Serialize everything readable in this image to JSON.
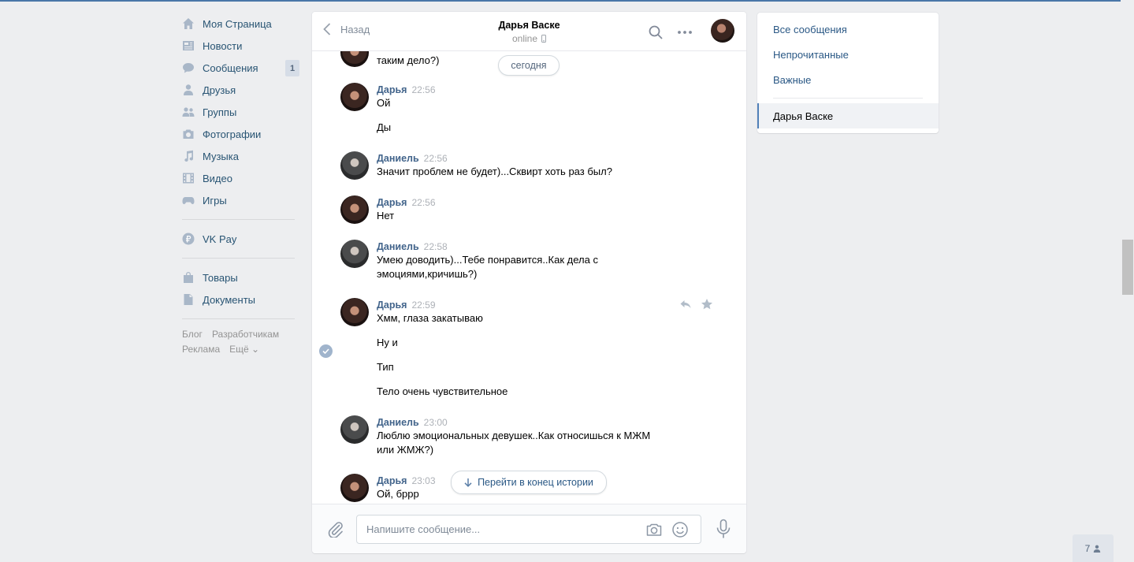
{
  "nav": {
    "items": [
      {
        "label": "Моя Страница",
        "icon": "home-icon"
      },
      {
        "label": "Новости",
        "icon": "news-icon"
      },
      {
        "label": "Сообщения",
        "icon": "messages-icon",
        "badge": "1"
      },
      {
        "label": "Друзья",
        "icon": "friends-icon"
      },
      {
        "label": "Группы",
        "icon": "groups-icon"
      },
      {
        "label": "Фотографии",
        "icon": "camera-icon"
      },
      {
        "label": "Музыка",
        "icon": "music-icon"
      },
      {
        "label": "Видео",
        "icon": "video-icon"
      },
      {
        "label": "Игры",
        "icon": "games-icon"
      }
    ],
    "vkpay": {
      "label": "VK Pay",
      "icon": "vkpay-icon"
    },
    "extra": [
      {
        "label": "Товары",
        "icon": "market-icon"
      },
      {
        "label": "Документы",
        "icon": "document-icon"
      }
    ],
    "footer": {
      "blog": "Блог",
      "developers": "Разработчикам",
      "ads": "Реклама",
      "more": "Ещё ⌄"
    }
  },
  "chat": {
    "back_label": "Назад",
    "peer_name": "Дарья Васке",
    "peer_status": "online",
    "today_label": "сегодня",
    "top_partial_text": "таким дело?)",
    "messages": [
      {
        "author": "Дарья",
        "time": "22:56",
        "lines": [
          "Ой",
          "Ды"
        ]
      },
      {
        "author": "Даниель",
        "time": "22:56",
        "lines": [
          "Значит проблем не будет)...Сквирт хоть раз был?"
        ]
      },
      {
        "author": "Дарья",
        "time": "22:56",
        "lines": [
          "Нет"
        ]
      },
      {
        "author": "Даниель",
        "time": "22:58",
        "lines": [
          "Умею доводить)...Тебе понравится..Как дела с эмоциями,кричишь?)"
        ]
      },
      {
        "author": "Дарья",
        "time": "22:59",
        "lines": [
          "Хмм, глаза закатываю",
          "Ну и",
          "Тип",
          "Тело очень чувствительное"
        ]
      },
      {
        "author": "Даниель",
        "time": "23:00",
        "lines": [
          "Люблю эмоциональных девушек..Как относишься к МЖМ или ЖМЖ?)"
        ]
      },
      {
        "author": "Дарья",
        "time": "23:03",
        "lines": [
          "Ой, бррр"
        ]
      }
    ],
    "jump_label": "Перейти в конец истории",
    "composer": {
      "placeholder": "Напишите сообщение..."
    }
  },
  "filters": {
    "all": "Все сообщения",
    "unread": "Непрочитанные",
    "important": "Важные",
    "active_chat": "Дарья Васке"
  },
  "online_count": "7",
  "colors": {
    "accent": "#4a76a8",
    "link": "#2a5885",
    "author": "#42648b",
    "background": "#edeef0"
  }
}
